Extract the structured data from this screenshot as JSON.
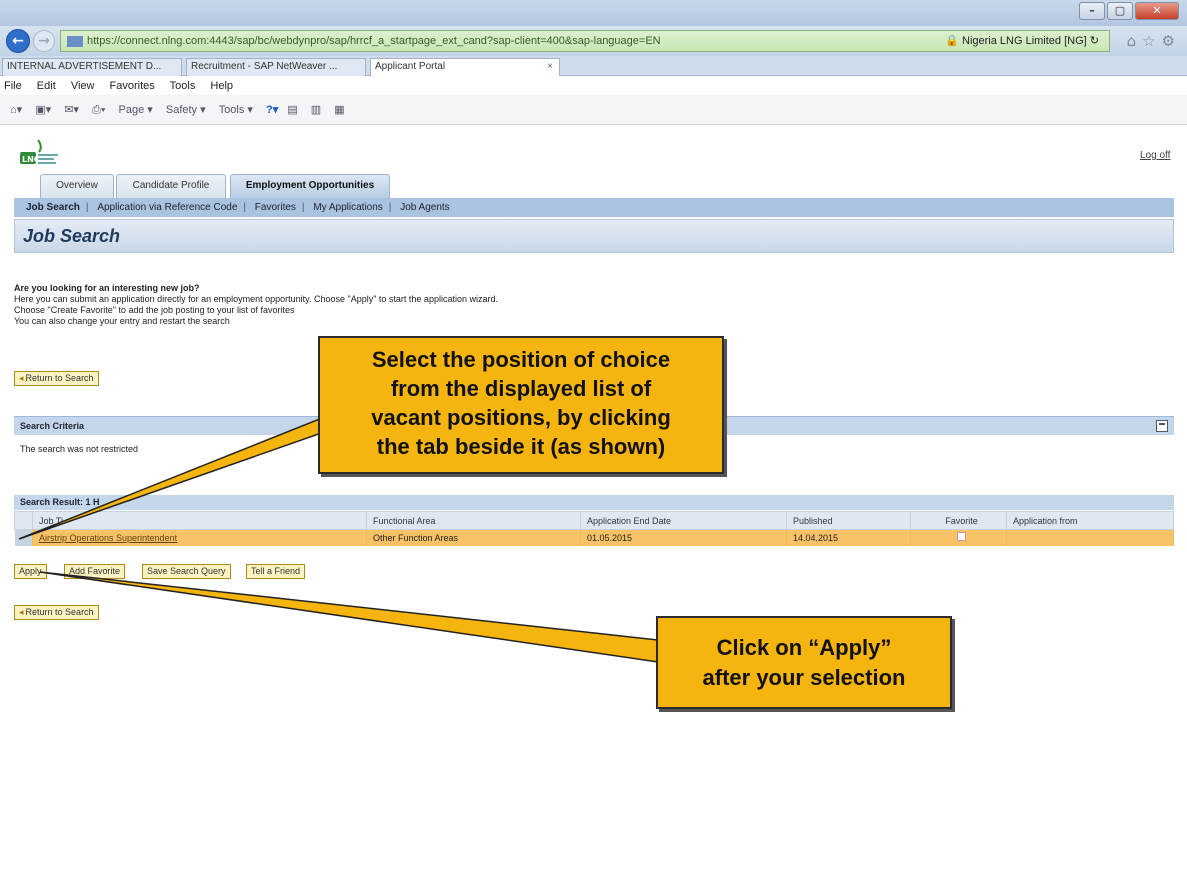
{
  "browser": {
    "url": "https://connect.nlng.com:4443/sap/bc/webdynpro/sap/hrrcf_a_startpage_ext_cand?sap-client=400&sap-language=EN",
    "site_identity": "Nigeria LNG Limited [NG]",
    "tabs": [
      {
        "label": "INTERNAL ADVERTISEMENT D...",
        "active": false
      },
      {
        "label": "Recruitment - SAP NetWeaver ...",
        "active": false
      },
      {
        "label": "Applicant Portal",
        "active": true
      }
    ],
    "menu": [
      "File",
      "Edit",
      "View",
      "Favorites",
      "Tools",
      "Help"
    ],
    "command_bar": [
      "Page ▾",
      "Safety ▾",
      "Tools ▾"
    ]
  },
  "portal": {
    "logoff": "Log off",
    "tabs": [
      {
        "label": "Overview"
      },
      {
        "label": "Candidate Profile"
      },
      {
        "label": "Employment Opportunities"
      }
    ],
    "subnav": [
      "Job Search",
      "Application via Reference Code",
      "Favorites",
      "My Applications",
      "Job Agents"
    ],
    "page_title": "Job Search",
    "intro": {
      "question": "Are you looking for an interesting new job?",
      "line1": "Here you can submit an application directly for an employment opportunity. Choose \"Apply\" to start the application wizard.",
      "line2": "Choose \"Create Favorite\" to add the job posting to your list of favorites",
      "line3": "You can also change your entry and restart the search"
    },
    "return_to_search": "Return to Search",
    "search_criteria": {
      "title": "Search Criteria",
      "text": "The search was not restricted"
    },
    "search_result": {
      "title": "Search Result: 1 H",
      "columns": [
        "Job Ti",
        "Functional Area",
        "Application End Date",
        "Published",
        "Favorite",
        "Application from"
      ],
      "rows": [
        {
          "job_title": "Airstrip Operations Superintendent",
          "functional_area": "Other Function Areas",
          "end_date": "01.05.2015",
          "published": "14.04.2015",
          "favorite": "",
          "application_from": ""
        }
      ]
    },
    "buttons": {
      "apply": "Apply",
      "add_favorite": "Add Favorite",
      "save_query": "Save Search Query",
      "tell_friend": "Tell a Friend"
    }
  },
  "annotations": {
    "callout1": [
      "Select the position of choice",
      "from the displayed list of",
      "vacant positions, by clicking",
      "the tab beside it (as shown)"
    ],
    "callout2": [
      "Click on “Apply”",
      "after your selection"
    ]
  },
  "colors": {
    "callout": "#f6b50e",
    "selected_row": "#f9c266",
    "subnav": "#a9c3e0",
    "url_bar": "#c9e6b5"
  }
}
